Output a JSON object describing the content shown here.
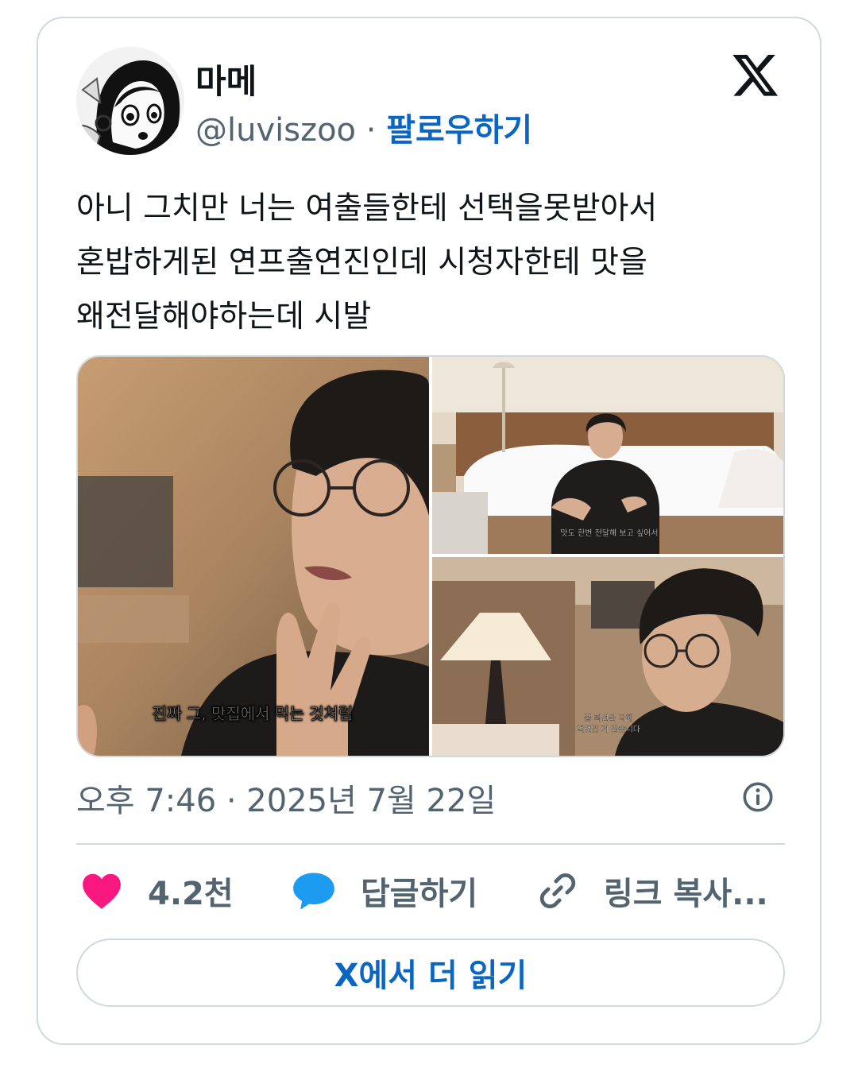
{
  "user": {
    "display_name": "마메",
    "handle": "@luviszoo",
    "separator": " · ",
    "follow_label": "팔로우하기"
  },
  "tweet": {
    "text": "아니 그치만 너는 여출들한테 선택을못받아서\n혼밥하게된 연프출연진인데 시청자한테 맛을\n왜전달해야하는데 시발",
    "timestamp": "오후 7:46 · 2025년 7월 22일"
  },
  "media": {
    "captions": [
      "진짜 그, 맛집에서 먹는 것처럼",
      "맛도 한번 전달해 보고 싶어서",
      "좀 최선을 다해",
      "먹었던 거 같습니다"
    ]
  },
  "actions": {
    "like_count": "4.2천",
    "reply_label": "답글하기",
    "copy_link_label": "링크 복사..."
  },
  "read_more_label": "X에서 더 읽기",
  "colors": {
    "like": "#f91880",
    "reply": "#1d9bf0",
    "link_blue": "#0a66c2",
    "muted_text": "#536471",
    "border": "#cfd9de"
  },
  "icons": [
    "x-logo-icon",
    "info-icon",
    "heart-icon",
    "speech-bubble-icon",
    "link-icon"
  ]
}
